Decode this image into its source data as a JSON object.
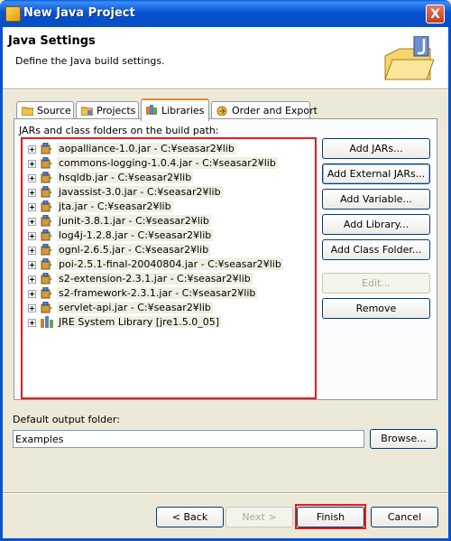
{
  "window": {
    "title": "New Java Project",
    "close_glyph": "X"
  },
  "banner": {
    "heading": "Java Settings",
    "description": "Define the Java build settings."
  },
  "tabs": [
    {
      "label": "Source",
      "icon": "source-folder-icon"
    },
    {
      "label": "Projects",
      "icon": "projects-icon"
    },
    {
      "label": "Libraries",
      "icon": "libraries-icon",
      "active": true
    },
    {
      "label": "Order and Export",
      "icon": "order-export-icon"
    }
  ],
  "libraries": {
    "section_label": "JARs and class folders on the build path:",
    "entries": [
      "aopalliance-1.0.jar - C:¥seasar2¥lib",
      "commons-logging-1.0.4.jar - C:¥seasar2¥lib",
      "hsqldb.jar - C:¥seasar2¥lib",
      "javassist-3.0.jar - C:¥seasar2¥lib",
      "jta.jar - C:¥seasar2¥lib",
      "junit-3.8.1.jar - C:¥seasar2¥lib",
      "log4j-1.2.8.jar - C:¥seasar2¥lib",
      "ognl-2.6.5.jar - C:¥seasar2¥lib",
      "poi-2.5.1-final-20040804.jar - C:¥seasar2¥lib",
      "s2-extension-2.3.1.jar - C:¥seasar2¥lib",
      "s2-framework-2.3.1.jar - C:¥seasar2¥lib",
      "servlet-api.jar - C:¥seasar2¥lib",
      "JRE System Library [jre1.5.0_05]"
    ],
    "buttons": {
      "add_jars": "Add JARs...",
      "add_external_jars": "Add External JARs...",
      "add_variable": "Add Variable...",
      "add_library": "Add Library...",
      "add_class_folder": "Add Class Folder...",
      "edit": "Edit...",
      "remove": "Remove"
    }
  },
  "output": {
    "label": "Default output folder:",
    "value": "Examples",
    "browse": "Browse..."
  },
  "footer": {
    "back": "< Back",
    "next": "Next >",
    "finish": "Finish",
    "cancel": "Cancel"
  },
  "colors": {
    "highlight": "#e81c1c",
    "titlebar": "#0854d1",
    "tab_accent": "#e68b2c"
  }
}
